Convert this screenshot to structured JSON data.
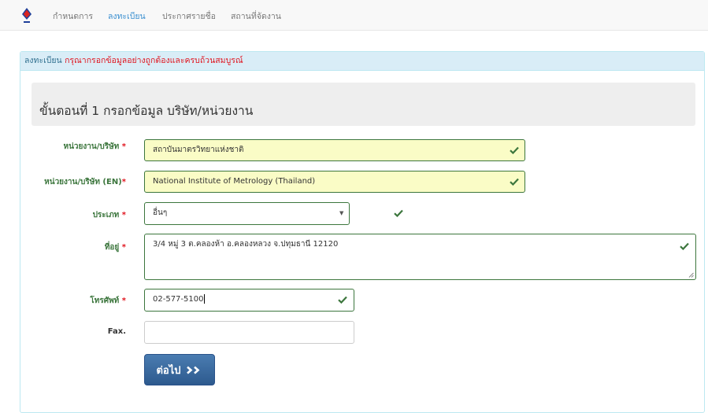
{
  "nav": {
    "items": [
      {
        "label": "กำหนดการ",
        "active": false
      },
      {
        "label": "ลงทะเบียน",
        "active": true
      },
      {
        "label": "ประกาศรายชื่อ",
        "active": false
      },
      {
        "label": "สถานที่จัดงาน",
        "active": false
      }
    ]
  },
  "panel": {
    "heading_prefix": "ลงทะเบียน",
    "heading_warning": "กรุณากรอกข้อมูลอย่างถูกต้องและครบถ้วนสมบูรณ์",
    "step_title": "ขั้นตอนที่ 1 กรอกข้อมูล บริษัท/หน่วยงาน"
  },
  "form": {
    "required_mark": "*",
    "company": {
      "label": "หน่วยงาน/บริษัท",
      "value": "สถาบันมาตรวิทยาแห่งชาติ"
    },
    "company_en": {
      "label": "หน่วยงาน/บริษัท (EN)",
      "value": "National Institute of Metrology (Thailand)"
    },
    "type": {
      "label": "ประเภท",
      "value": "อื่นๆ"
    },
    "address": {
      "label": "ที่อยู่",
      "value": "3/4 หมู่ 3 ต.คลองห้า อ.คลองหลวง จ.ปทุมธานี 12120"
    },
    "phone": {
      "label": "โทรศัพท์",
      "value": "02-577-5100"
    },
    "fax": {
      "label": "Fax.",
      "value": ""
    },
    "next_button": "ต่อไป"
  },
  "colors": {
    "valid_border": "#3c763d",
    "valid_fill": "#fafcc6",
    "required": "#e0141e",
    "panel_heading_bg": "#d9edf7",
    "button_bg": "#3a6ea5"
  }
}
